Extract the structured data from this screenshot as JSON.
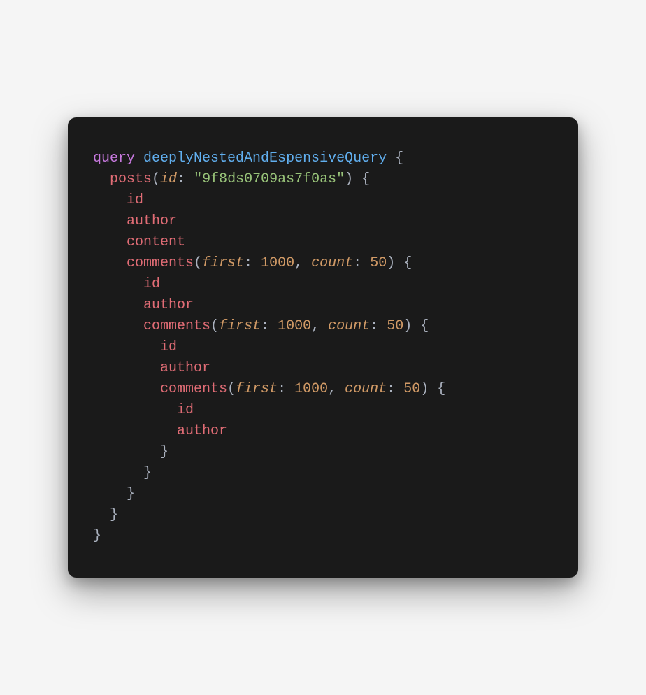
{
  "code": {
    "keyword_query": "query",
    "query_name": "deeplyNestedAndEspensiveQuery",
    "open_brace": "{",
    "close_brace": "}",
    "open_paren": "(",
    "close_paren": ")",
    "colon": ":",
    "comma": ",",
    "posts_field": "posts",
    "id_arg": "id",
    "id_value": "\"9f8ds0709as7f0as\"",
    "id_field": "id",
    "author_field": "author",
    "content_field": "content",
    "comments_field": "comments",
    "first_arg": "first",
    "first_value": "1000",
    "count_arg": "count",
    "count_value": "50"
  }
}
